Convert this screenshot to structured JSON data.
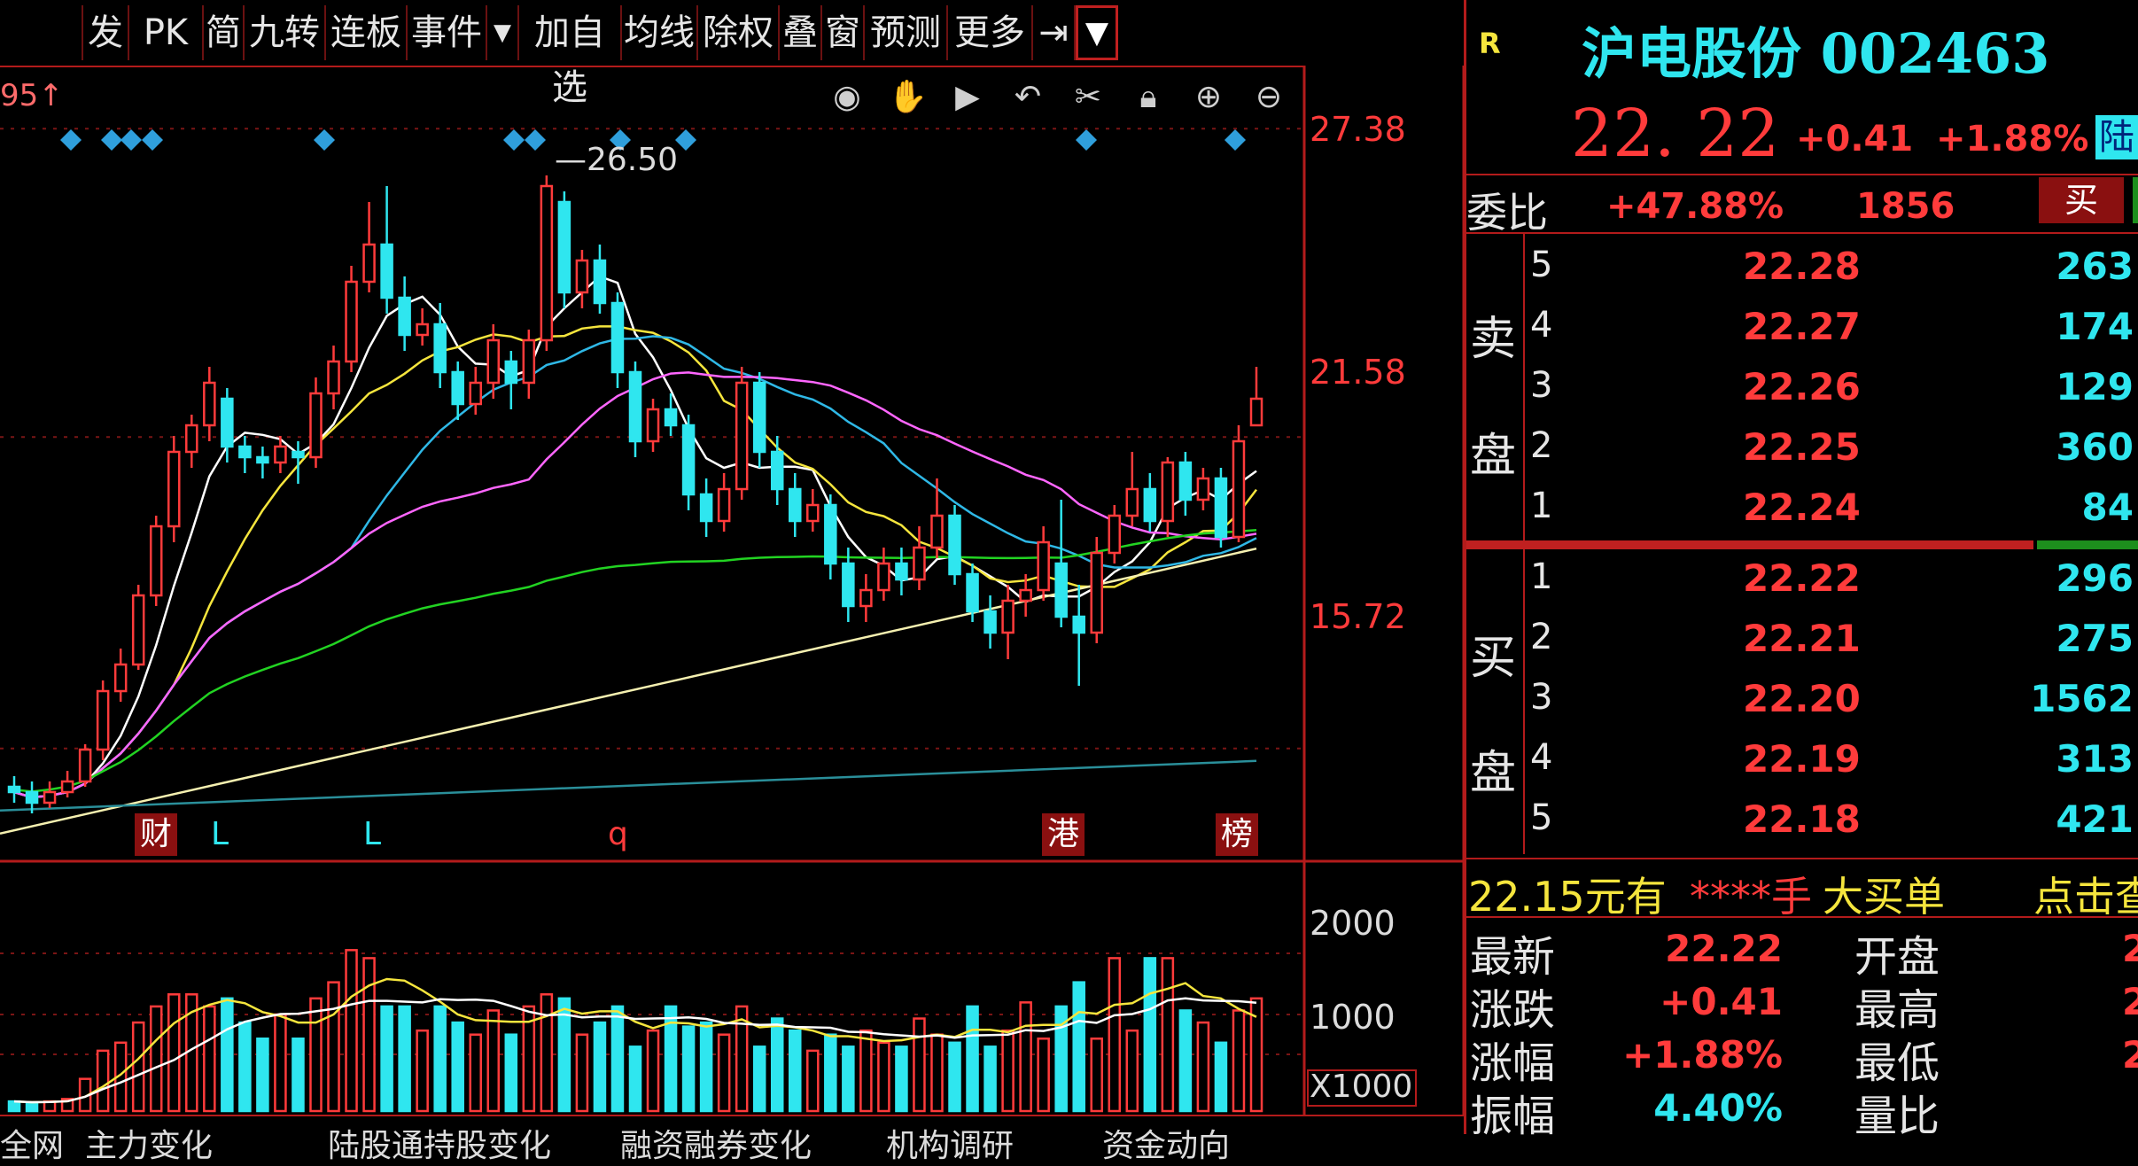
{
  "toolbar": {
    "items": [
      "发",
      "PK",
      "简",
      "九转",
      "连板",
      "事件",
      "加自选",
      "均线",
      "除权",
      "叠",
      "窗",
      "预测",
      "更多"
    ],
    "dropdown_icon": "chevron-down-icon",
    "overflow_icon": "arrow-right-icon"
  },
  "chart": {
    "corner_label": "95↑",
    "high_marker": "26.50",
    "price_axis": [
      "27.38",
      "21.58",
      "15.72"
    ],
    "volume_axis": [
      "2000",
      "1000",
      "X1000"
    ],
    "events": [
      {
        "text": "财",
        "color": "#ffffff",
        "bg": "#8a1010"
      },
      {
        "text": "L",
        "color": "#2fe6ef",
        "bg": ""
      },
      {
        "text": "L",
        "color": "#2fe6ef",
        "bg": ""
      },
      {
        "text": "q",
        "color": "#ff3b3b",
        "bg": ""
      },
      {
        "text": "港",
        "color": "#ffffff",
        "bg": "#8a1010"
      },
      {
        "text": "榜",
        "color": "#ffffff",
        "bg": "#8a1010"
      }
    ],
    "tools": [
      "eye-icon",
      "hand-icon",
      "play-icon",
      "undo-icon",
      "scissors-icon",
      "lock-icon",
      "zoom-in-icon",
      "zoom-out-icon"
    ],
    "colors": {
      "up": "#ff3b3b",
      "down": "#2fe6ef",
      "ma5": "#ffffff",
      "ma10": "#f5e53d",
      "ma20": "#2fb8e6",
      "ma30": "#ff66ff",
      "ma60": "#22d322",
      "ma120": "#f5f0b0",
      "ma250": "#2a8f9a"
    }
  },
  "quote": {
    "r_label": "R",
    "name": "沪电股份 002463",
    "price": "22. 22",
    "change": "+0.41",
    "change_pct": "+1.88%",
    "tag": "陆",
    "weibi_label": "委比",
    "weibi_pct": "+47.88%",
    "weicha": "1856",
    "buy_btn": "买",
    "sell_side_label": [
      "卖",
      "盘"
    ],
    "buy_side_label": [
      "买",
      "盘"
    ],
    "asks": [
      {
        "level": "5",
        "price": "22.28",
        "vol": "263"
      },
      {
        "level": "4",
        "price": "22.27",
        "vol": "174"
      },
      {
        "level": "3",
        "price": "22.26",
        "vol": "129"
      },
      {
        "level": "2",
        "price": "22.25",
        "vol": "360"
      },
      {
        "level": "1",
        "price": "22.24",
        "vol": "84"
      }
    ],
    "bids": [
      {
        "level": "1",
        "price": "22.22",
        "vol": "296"
      },
      {
        "level": "2",
        "price": "22.21",
        "vol": "275"
      },
      {
        "level": "3",
        "price": "22.20",
        "vol": "1562"
      },
      {
        "level": "4",
        "price": "22.19",
        "vol": "313"
      },
      {
        "level": "5",
        "price": "22.18",
        "vol": "421"
      }
    ],
    "big_order": {
      "price": "22.15元有",
      "hands": "****手",
      "label": "大买单",
      "action": "点击查"
    },
    "stats": [
      {
        "k": "最新",
        "v": "22.22",
        "k2": "开盘",
        "v2": "2"
      },
      {
        "k": "涨跌",
        "v": "+0.41",
        "k2": "最高",
        "v2": "2"
      },
      {
        "k": "涨幅",
        "v": "+1.88%",
        "k2": "最低",
        "v2": "2"
      },
      {
        "k": "振幅",
        "v": "4.40%",
        "k2": "量比",
        "v2": ""
      }
    ]
  },
  "bottom_tabs": [
    "全网",
    "主力变化",
    "陆股通持股变化",
    "融资融券变化",
    "机构调研",
    "资金动向"
  ],
  "chart_data": {
    "type": "candlestick",
    "price_ylim": [
      13.9,
      27.9
    ],
    "candles": [
      [
        15.0,
        14.9,
        15.2,
        14.7
      ],
      [
        14.9,
        14.7,
        15.1,
        14.5
      ],
      [
        14.7,
        14.9,
        15.1,
        14.6
      ],
      [
        14.9,
        15.1,
        15.3,
        14.8
      ],
      [
        15.1,
        15.7,
        15.8,
        15.0
      ],
      [
        15.7,
        16.8,
        17.0,
        15.5
      ],
      [
        16.8,
        17.3,
        17.6,
        16.6
      ],
      [
        17.3,
        18.6,
        18.8,
        17.2
      ],
      [
        18.6,
        19.9,
        20.1,
        18.4
      ],
      [
        19.9,
        21.3,
        21.6,
        19.6
      ],
      [
        21.3,
        21.8,
        22.0,
        21.0
      ],
      [
        21.8,
        22.6,
        22.9,
        21.5
      ],
      [
        22.3,
        21.4,
        22.5,
        21.1
      ],
      [
        21.4,
        21.2,
        21.6,
        20.9
      ],
      [
        21.2,
        21.1,
        21.4,
        20.8
      ],
      [
        21.1,
        21.4,
        21.6,
        20.9
      ],
      [
        21.3,
        21.2,
        21.5,
        20.7
      ],
      [
        21.2,
        22.4,
        22.7,
        21.0
      ],
      [
        22.4,
        23.0,
        23.3,
        22.1
      ],
      [
        23.0,
        24.5,
        24.8,
        22.8
      ],
      [
        24.5,
        25.2,
        26.0,
        24.3
      ],
      [
        25.2,
        24.2,
        26.3,
        23.9
      ],
      [
        24.2,
        23.5,
        24.6,
        23.2
      ],
      [
        23.5,
        23.7,
        24.0,
        23.3
      ],
      [
        23.7,
        22.8,
        24.1,
        22.5
      ],
      [
        22.8,
        22.2,
        23.0,
        21.9
      ],
      [
        22.2,
        22.6,
        22.9,
        22.0
      ],
      [
        22.6,
        23.4,
        23.7,
        22.3
      ],
      [
        23.0,
        22.6,
        23.2,
        22.1
      ],
      [
        22.6,
        23.4,
        23.6,
        22.3
      ],
      [
        23.4,
        26.3,
        26.5,
        23.2
      ],
      [
        26.0,
        24.3,
        26.2,
        24.0
      ],
      [
        24.3,
        24.9,
        25.1,
        24.0
      ],
      [
        24.9,
        24.1,
        25.2,
        23.9
      ],
      [
        24.1,
        22.8,
        24.3,
        22.5
      ],
      [
        22.8,
        21.5,
        23.0,
        21.2
      ],
      [
        21.5,
        22.1,
        22.3,
        21.3
      ],
      [
        22.1,
        21.8,
        22.4,
        21.6
      ],
      [
        21.8,
        20.5,
        22.0,
        20.2
      ],
      [
        20.5,
        20.0,
        20.8,
        19.7
      ],
      [
        20.0,
        20.6,
        20.9,
        19.8
      ],
      [
        20.6,
        22.6,
        22.9,
        20.4
      ],
      [
        22.6,
        21.3,
        22.8,
        21.0
      ],
      [
        21.3,
        20.6,
        21.6,
        20.3
      ],
      [
        20.6,
        20.0,
        20.9,
        19.7
      ],
      [
        20.0,
        20.3,
        20.6,
        19.8
      ],
      [
        20.3,
        19.2,
        20.5,
        18.9
      ],
      [
        19.2,
        18.4,
        19.5,
        18.1
      ],
      [
        18.4,
        18.7,
        19.0,
        18.1
      ],
      [
        18.7,
        19.2,
        19.5,
        18.5
      ],
      [
        19.2,
        18.9,
        19.5,
        18.6
      ],
      [
        18.9,
        19.5,
        19.9,
        18.7
      ],
      [
        19.5,
        20.1,
        20.8,
        19.3
      ],
      [
        20.1,
        19.0,
        20.3,
        18.8
      ],
      [
        19.0,
        18.3,
        19.2,
        18.1
      ],
      [
        18.3,
        17.9,
        18.6,
        17.6
      ],
      [
        17.9,
        18.5,
        18.8,
        17.4
      ],
      [
        18.5,
        18.7,
        19.0,
        18.2
      ],
      [
        18.7,
        19.6,
        19.9,
        18.5
      ],
      [
        19.2,
        18.2,
        20.4,
        18.0
      ],
      [
        18.2,
        17.9,
        18.8,
        16.9
      ],
      [
        17.9,
        19.4,
        19.7,
        17.7
      ],
      [
        19.4,
        20.1,
        20.3,
        19.2
      ],
      [
        20.1,
        20.6,
        21.3,
        19.9
      ],
      [
        20.6,
        20.0,
        20.9,
        19.8
      ],
      [
        20.0,
        21.1,
        21.2,
        19.7
      ],
      [
        21.1,
        20.4,
        21.3,
        20.1
      ],
      [
        20.4,
        20.8,
        21.0,
        20.2
      ],
      [
        20.8,
        19.7,
        21.0,
        19.5
      ],
      [
        19.7,
        21.5,
        21.8,
        19.6
      ],
      [
        21.8,
        22.3,
        22.9,
        21.9
      ]
    ],
    "volumes": [
      0.12,
      0.1,
      0.12,
      0.15,
      0.4,
      0.75,
      0.85,
      1.1,
      1.3,
      1.45,
      1.45,
      1.3,
      1.4,
      1.1,
      0.9,
      1.2,
      0.9,
      1.4,
      1.6,
      2.0,
      1.9,
      1.3,
      1.3,
      1.0,
      1.3,
      1.1,
      0.95,
      1.25,
      0.95,
      1.3,
      1.45,
      1.4,
      0.95,
      1.1,
      1.3,
      0.8,
      1.0,
      1.3,
      1.05,
      1.1,
      0.95,
      1.3,
      0.8,
      1.15,
      1.0,
      0.75,
      0.95,
      0.8,
      1.0,
      0.85,
      0.8,
      1.15,
      0.95,
      0.85,
      1.3,
      0.8,
      1.0,
      1.35,
      0.9,
      1.3,
      1.6,
      0.9,
      1.9,
      1.0,
      1.9,
      1.9,
      1.25,
      1.1,
      0.85,
      1.25,
      1.4
    ],
    "volume_ylim": [
      0,
      2400
    ]
  }
}
